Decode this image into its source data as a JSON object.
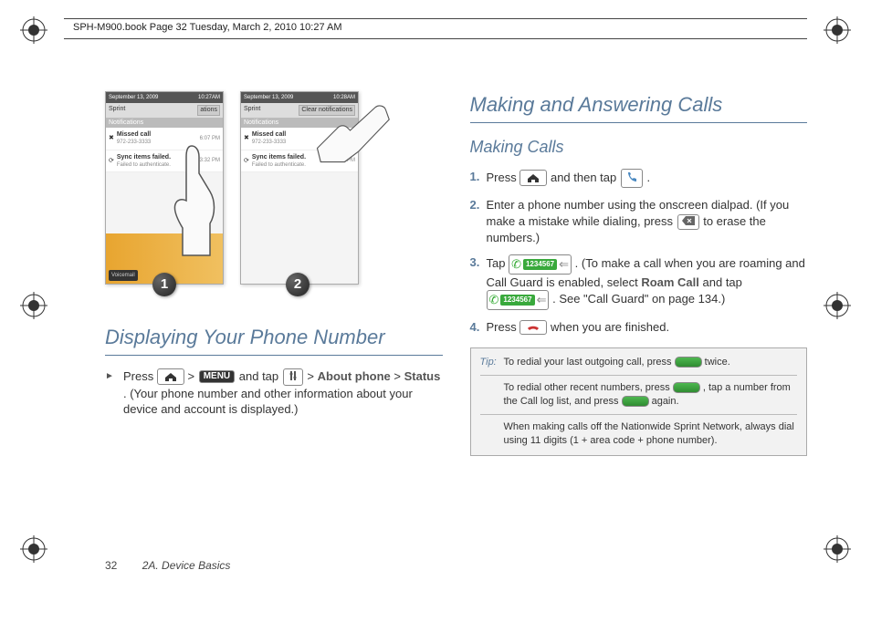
{
  "crop_header": "SPH-M900.book  Page 32  Tuesday, March 2, 2010  10:27 AM",
  "footer": {
    "page": "32",
    "section": "2A. Device Basics"
  },
  "screenshots": {
    "shot1": {
      "status_left": "September 13, 2009",
      "status_right": "10:27AM",
      "carrier": "Sprint",
      "clear_btn": "ations",
      "notif_header": "Notifications",
      "row1_title": "Missed call",
      "row1_sub": "972-233-3333",
      "row1_time": "6:07 PM",
      "row2_title": "Sync items failed.",
      "row2_sub": "Failed to authenticate.",
      "row2_time": "3:32 PM"
    },
    "shot2": {
      "status_left": "September 13, 2009",
      "status_right": "10:28AM",
      "carrier": "Sprint",
      "clear_btn": "Clear notifications",
      "notif_header": "Notifications",
      "row1_title": "Missed call",
      "row1_sub": "972-233-3333",
      "row1_time": "6:07 PM",
      "row2_title": "Sync items failed.",
      "row2_sub": "Failed to authenticate.",
      "row2_time": "3:32 PM"
    },
    "badge1": "1",
    "badge2": "2"
  },
  "left": {
    "heading": "Displaying Your Phone Number",
    "step_pre": "Press ",
    "menu_label": "MENU",
    "step_mid1": " and tap ",
    "about_label": "About phone",
    "status_label": "Status",
    "step_paren": ". (Your phone number and other information about your device and account is displayed.)"
  },
  "right": {
    "heading": "Making and Answering Calls",
    "sub": "Making Calls",
    "s1_a": "Press ",
    "s1_b": " and then tap ",
    "s1_c": " .",
    "s2": "Enter a phone number using the onscreen dialpad. (If you make a mistake while dialing, press ",
    "s2_end": " to erase the numbers.)",
    "s3_a": "Tap ",
    "call_number": "1234567",
    "s3_b": " . (To make a call when you are roaming and Call Guard is enabled, select ",
    "roam_label": "Roam Call",
    "s3_c": " and tap ",
    "s3_d": " . See \"Call Guard\" on page 134.)",
    "s4_a": "Press ",
    "s4_b": " when you are finished."
  },
  "tip": {
    "label": "Tip:",
    "t1_a": "To redial your last outgoing call, press ",
    "t1_b": " twice.",
    "t2_a": "To redial other recent numbers, press ",
    "t2_b": ", tap a number from the Call log list, and press ",
    "t2_c": " again.",
    "t3": "When making calls off the Nationwide Sprint Network, always dial using 11 digits (1 + area code + phone number)."
  }
}
